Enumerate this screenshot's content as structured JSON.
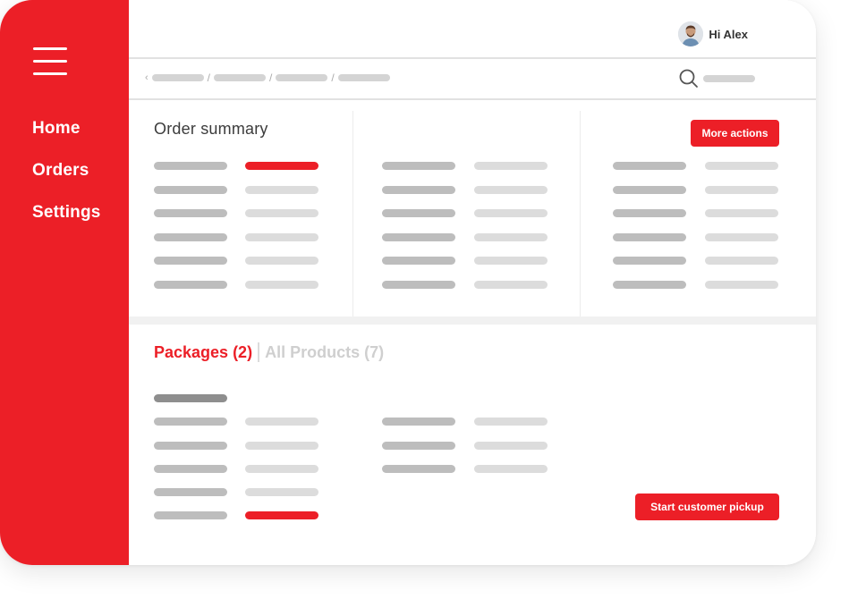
{
  "sidebar": {
    "menu_icon": "hamburger-menu-icon",
    "items": [
      {
        "label": "Home"
      },
      {
        "label": "Orders"
      },
      {
        "label": "Settings"
      }
    ]
  },
  "header": {
    "greeting": "Hi Alex",
    "avatar_icon": "user-avatar"
  },
  "subbar": {
    "back_icon": "chevron-left-icon",
    "search_icon": "search-icon"
  },
  "summary": {
    "title": "Order summary",
    "more_actions_label": "More actions"
  },
  "packages": {
    "tab_packages": "Packages (2)",
    "tab_products": "All Products (7)",
    "pickup_label": "Start customer pickup"
  },
  "colors": {
    "brand_red": "#ec1f27",
    "placeholder_dark": "#bdbdbd",
    "placeholder_light": "#dcdcdc"
  }
}
